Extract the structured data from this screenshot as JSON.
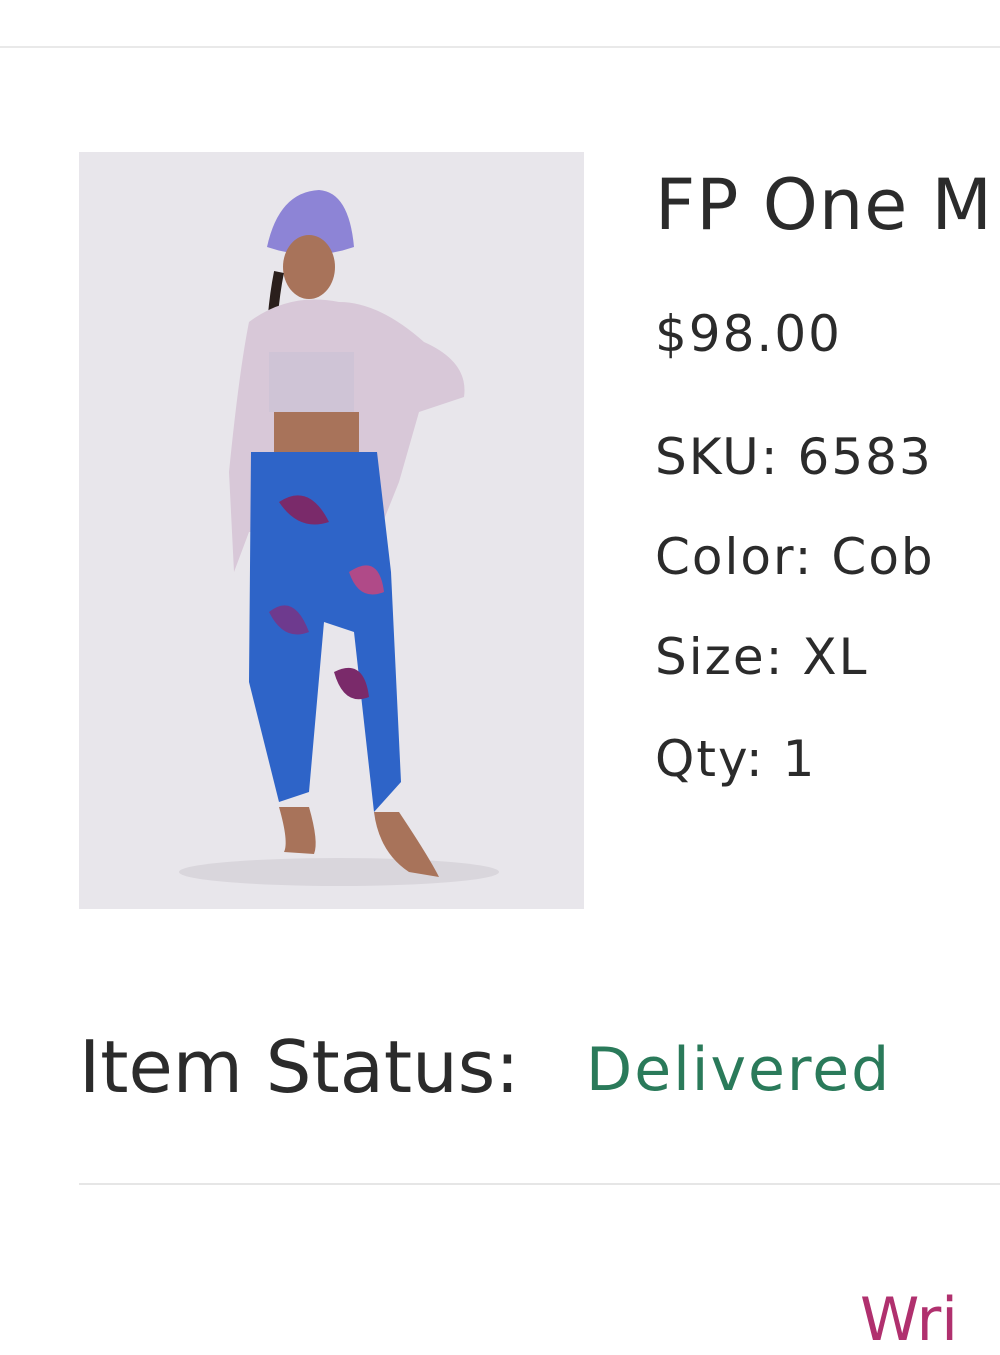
{
  "item": {
    "name": "FP One M",
    "price": "$98.00",
    "sku": "SKU: 6583",
    "color": "Color: Cob",
    "size": "Size: XL",
    "qty": "Qty: 1"
  },
  "status": {
    "label": "Item Status:",
    "value": "Delivered",
    "value_color": "#2a7a5a"
  },
  "actions": {
    "write_review": "Wri",
    "link_color": "#b0306e"
  }
}
